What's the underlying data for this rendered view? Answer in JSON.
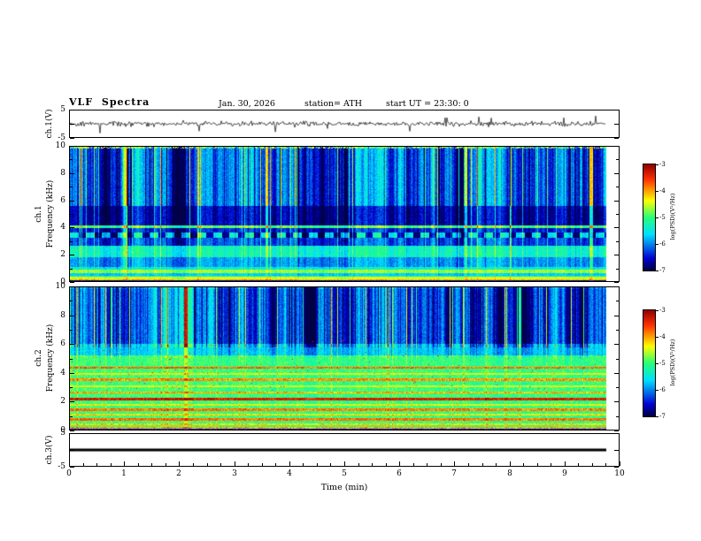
{
  "header": {
    "title": "VLF Spectra",
    "date": "Jan. 30, 2026",
    "station": "station= ATH",
    "start_ut": "start UT =  23:30: 0"
  },
  "xaxis": {
    "label": "Time (min)",
    "range": [
      0,
      10
    ],
    "ticks": [
      0,
      1,
      2,
      3,
      4,
      5,
      6,
      7,
      8,
      9,
      10
    ],
    "data_extent_min": 9.78
  },
  "colorbar": {
    "label": "log(PSD)(V²/Hz)",
    "ticks": [
      -3,
      -4,
      -5,
      -6,
      -7
    ],
    "range": [
      -7,
      -3
    ],
    "colormap": "jet (red = -3 high PSD, dark blue = -7 low PSD)"
  },
  "chart_data": [
    {
      "panel": "ch1-voltage",
      "type": "line",
      "ylabel": "ch.1(V)",
      "ylim": [
        -5,
        5
      ],
      "yticks": [
        5,
        -5
      ],
      "xlim": [
        0,
        10
      ],
      "signal": "broadband noise trace centered at 0 V, amplitude about ±1.5 V with occasional impulsive spikes to ±3 V, black 1-px line"
    },
    {
      "panel": "ch1-spectrogram",
      "type": "heatmap",
      "ylabel_channel": "ch.1",
      "ylabel_axis": "Frequency (kHz)",
      "ylim": [
        0,
        10
      ],
      "yticks": [
        10,
        8,
        6,
        4,
        2,
        0
      ],
      "xlim": [
        0,
        10
      ],
      "zlabel": "log(PSD)(V²/Hz)",
      "zlim": [
        -7,
        -3
      ],
      "features": {
        "background_psd_above_5khz": -6.25,
        "dark_band_khz": [
          4.2,
          5.6
        ],
        "bright_horizontal_lines_khz": [
          4.0,
          0.7,
          0.2
        ],
        "greenish_band_khz": [
          1.8,
          2.6
        ],
        "dashed_periodic_row_khz": 3.4,
        "sferics": "dense vertical blue/cyan/green striations spanning 0-10 kHz, strong full-height green burst near 1 min",
        "top_edge": "bright green speckles at 10 kHz"
      }
    },
    {
      "panel": "ch2-spectrogram",
      "type": "heatmap",
      "ylabel_channel": "ch.2",
      "ylabel_axis": "Frequency (kHz)",
      "ylim": [
        0,
        10
      ],
      "yticks": [
        10,
        8,
        6,
        4,
        2,
        0
      ],
      "xlim": [
        0,
        10
      ],
      "zlabel": "log(PSD)(V²/Hz)",
      "zlim": [
        -7,
        -3
      ],
      "features": {
        "background_psd_above_5khz": -6.2,
        "background_psd_below_5khz": -5.0,
        "horizontal_lines_khz": [
          4.35,
          3.9,
          3.5,
          3.05,
          2.6,
          2.15,
          1.7,
          1.4,
          1.0,
          0.7,
          0.35
        ],
        "strongest_line_khz": 2.15,
        "line_psd_levels": [
          -3.8,
          -4.35,
          -3.95,
          -4.4,
          -4.05,
          -3.35,
          -4.35,
          -3.85,
          -4.25,
          -3.8,
          -4.2
        ],
        "sferics": "dense vertical blue/cyan striations above 5 kHz, scattered red/orange speckles 3-6 kHz"
      }
    },
    {
      "panel": "ch3-voltage",
      "type": "line",
      "ylabel": "ch.3(V)",
      "ylim": [
        -5,
        5
      ],
      "yticks": [
        5,
        -5
      ],
      "xlim": [
        0,
        10
      ],
      "xlabel": "Time (min)",
      "signal": "flat thick black line at 0 V (channel inactive)"
    }
  ]
}
